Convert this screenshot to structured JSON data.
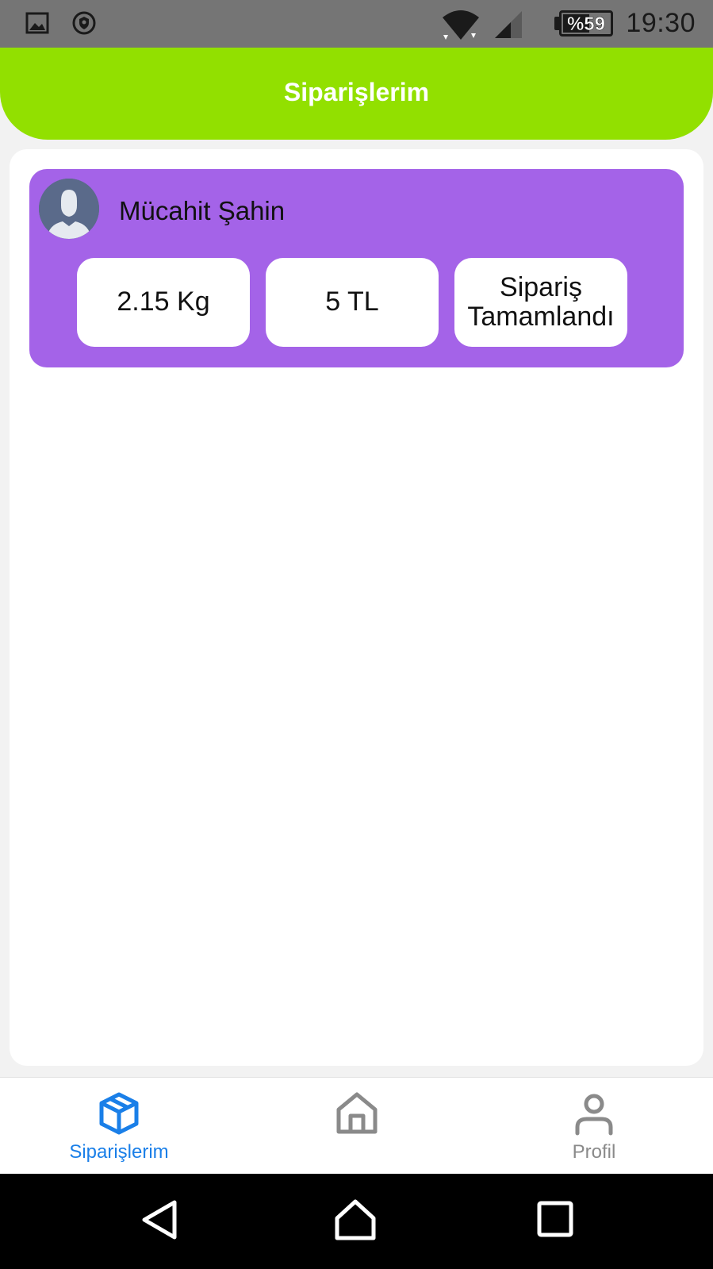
{
  "status_bar": {
    "time": "19:30",
    "battery_text": "%59",
    "battery_level": 0.59,
    "icons": [
      "image-icon",
      "shield-icon",
      "wifi-icon",
      "cellular-icon",
      "battery-icon"
    ]
  },
  "header": {
    "title": "Siparişlerim"
  },
  "orders": [
    {
      "customer_name": "Mücahit Şahin",
      "weight": "2.15 Kg",
      "price": "5 TL",
      "status": "Sipariş Tamamlandı",
      "avatar_icon": "default-user-avatar"
    }
  ],
  "bottom_nav": {
    "items": [
      {
        "label": "Siparişlerim",
        "icon": "package-icon",
        "active": true
      },
      {
        "label": "",
        "icon": "home-icon",
        "active": false
      },
      {
        "label": "Profil",
        "icon": "person-icon",
        "active": false
      }
    ],
    "active_color": "#1a7fe8",
    "inactive_color": "#8a8a8a"
  },
  "system_nav": {
    "buttons": [
      "back-icon",
      "home-circle-icon",
      "recents-icon"
    ]
  },
  "colors": {
    "header": "#92e000",
    "card": "#a463e8",
    "status_bar": "#757575"
  }
}
